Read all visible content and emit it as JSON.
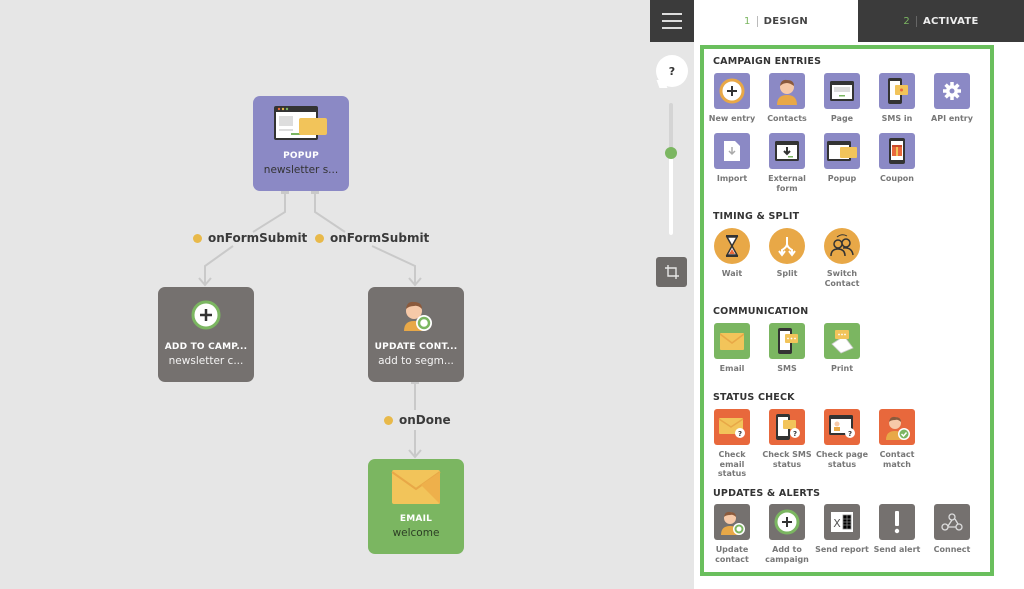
{
  "tabs": [
    {
      "num": "1",
      "label": "DESIGN",
      "active": true
    },
    {
      "num": "2",
      "label": "ACTIVATE",
      "active": false
    }
  ],
  "toolbar": {
    "menu_icon": "hamburger-icon",
    "help_label": "?",
    "zoom_level": 0.62,
    "crop_icon": "crop-icon"
  },
  "canvas": {
    "nodes": [
      {
        "id": "popup",
        "type": "POPUP",
        "subtitle": "newsletter s...",
        "color": "#8b89c5",
        "icon": "popup-icon"
      },
      {
        "id": "add-campaign",
        "type": "ADD TO CAMP...",
        "subtitle": "newsletter c...",
        "color": "#75716f",
        "icon": "add-to-campaign-icon"
      },
      {
        "id": "update-contact",
        "type": "UPDATE CONT...",
        "subtitle": "add to segm...",
        "color": "#75716f",
        "icon": "update-contact-icon"
      },
      {
        "id": "email",
        "type": "EMAIL",
        "subtitle": "welcome",
        "color": "#7bb661",
        "icon": "email-icon"
      }
    ],
    "edges": [
      {
        "from": "popup",
        "to": "add-campaign",
        "label": "onFormSubmit"
      },
      {
        "from": "popup",
        "to": "update-contact",
        "label": "onFormSubmit"
      },
      {
        "from": "update-contact",
        "to": "email",
        "label": "onDone"
      }
    ],
    "edge_dot_color": "#e8b94a"
  },
  "palette": {
    "border_color": "#6abf5d",
    "sections": [
      {
        "title": "CAMPAIGN ENTRIES",
        "items": [
          {
            "label": "New entry",
            "icon": "new-entry-icon"
          },
          {
            "label": "Contacts",
            "icon": "contacts-icon"
          },
          {
            "label": "Page",
            "icon": "page-icon"
          },
          {
            "label": "SMS in",
            "icon": "sms-in-icon"
          },
          {
            "label": "API entry",
            "icon": "gear-icon"
          },
          {
            "label": "Import",
            "icon": "import-icon"
          },
          {
            "label": "External form",
            "icon": "external-form-icon"
          },
          {
            "label": "Popup",
            "icon": "popup-icon"
          },
          {
            "label": "Coupon",
            "icon": "coupon-icon"
          }
        ]
      },
      {
        "title": "TIMING & SPLIT",
        "items": [
          {
            "label": "Wait",
            "icon": "hourglass-icon"
          },
          {
            "label": "Split",
            "icon": "split-icon"
          },
          {
            "label": "Switch Contact",
            "icon": "switch-contact-icon"
          }
        ]
      },
      {
        "title": "COMMUNICATION",
        "items": [
          {
            "label": "Email",
            "icon": "email-icon"
          },
          {
            "label": "SMS",
            "icon": "sms-icon"
          },
          {
            "label": "Print",
            "icon": "print-icon"
          }
        ]
      },
      {
        "title": "STATUS CHECK",
        "items": [
          {
            "label": "Check email status",
            "icon": "check-email-status-icon"
          },
          {
            "label": "Check SMS status",
            "icon": "check-sms-status-icon"
          },
          {
            "label": "Check page status",
            "icon": "check-page-status-icon"
          },
          {
            "label": "Contact match",
            "icon": "contact-match-icon"
          }
        ]
      },
      {
        "title": "UPDATES & ALERTS",
        "items": [
          {
            "label": "Update contact",
            "icon": "update-contact-icon"
          },
          {
            "label": "Add to campaign",
            "icon": "add-to-campaign-icon"
          },
          {
            "label": "Send report",
            "icon": "excel-report-icon"
          },
          {
            "label": "Send alert",
            "icon": "exclamation-icon"
          },
          {
            "label": "Connect",
            "icon": "webhook-icon"
          }
        ]
      }
    ]
  }
}
